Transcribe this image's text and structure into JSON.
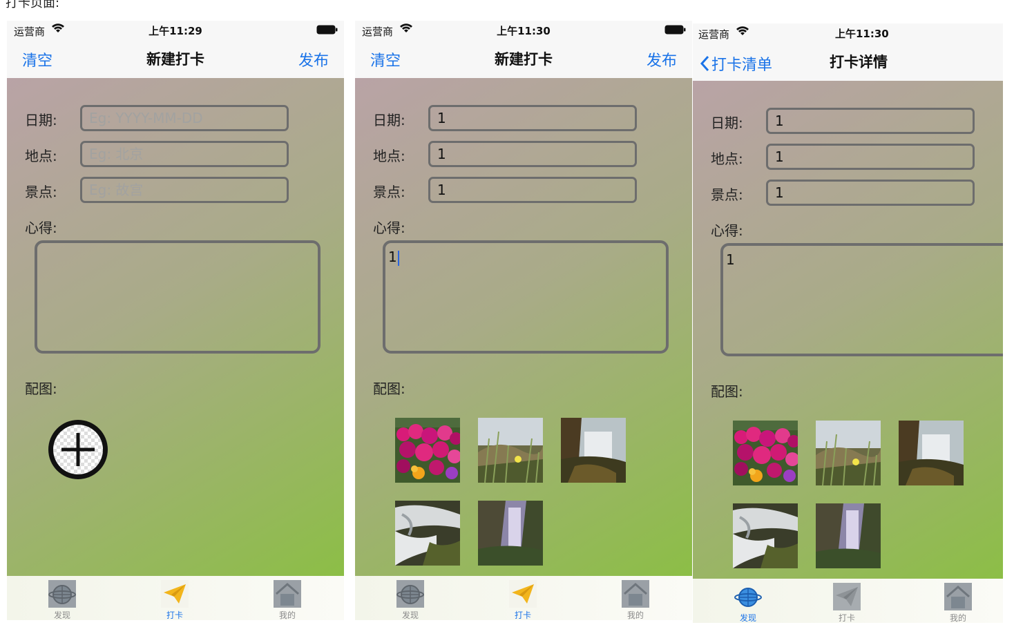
{
  "caption": "打卡页面:",
  "status": {
    "carrier": "运营商",
    "time_1": "上午11:29",
    "time_2": "上午11:30",
    "time_3": "上午11:30"
  },
  "labels": {
    "date": "日期:",
    "location": "地点:",
    "scenic": "景点:",
    "notes": "心得:",
    "images": "配图:"
  },
  "screen1": {
    "nav": {
      "left": "清空",
      "title": "新建打卡",
      "right": "发布"
    },
    "placeholders": {
      "date": "Eg: YYYY-MM-DD",
      "location": "Eg: 北京",
      "scenic": "Eg: 故宫"
    }
  },
  "screen2": {
    "nav": {
      "left": "清空",
      "title": "新建打卡",
      "right": "发布"
    },
    "values": {
      "date": "1",
      "location": "1",
      "scenic": "1",
      "notes": "1"
    }
  },
  "screen3": {
    "nav": {
      "back": "打卡清单",
      "title": "打卡详情"
    },
    "values": {
      "date": "1",
      "location": "1",
      "scenic": "1",
      "notes": "1"
    }
  },
  "tabs": [
    {
      "label": "发现",
      "icon": "globe-icon"
    },
    {
      "label": "打卡",
      "icon": "paper-plane-icon"
    },
    {
      "label": "我的",
      "icon": "house-icon"
    }
  ],
  "colors": {
    "accent": "#1a73e8",
    "field_border": "#6d6d6d"
  }
}
